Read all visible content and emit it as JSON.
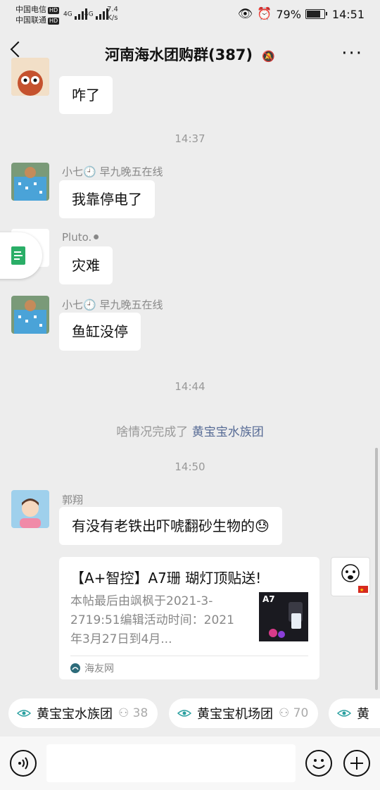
{
  "status_bar": {
    "carrier1": "中国电信",
    "carrier2": "中国联通",
    "hd": "HD",
    "sig": "4G",
    "speed": "7.4",
    "speed_unit": "K/s",
    "battery": "79%",
    "battery_level": 0.79,
    "time": "14:51"
  },
  "nav": {
    "title": "河南海水团购群(387)",
    "more": "···"
  },
  "messages": {
    "m1": {
      "text": "咋了"
    },
    "t1": "14:37",
    "m2": {
      "sender": "小七🕘 早九晚五在线",
      "text": "我靠停电了"
    },
    "m3": {
      "sender": "Pluto.⚫",
      "text": "灾难"
    },
    "m4": {
      "sender": "小七🕘 早九晚五在线",
      "text": "鱼缸没停"
    },
    "t2": "14:44",
    "sys": {
      "prefix": "啥情况完成了",
      "link": "黄宝宝水族团"
    },
    "t3": "14:50",
    "m5": {
      "sender": "郭翔",
      "text": "有没有老铁出吓唬翻砂生物的😓"
    },
    "card": {
      "title": "【A+智控】A7珊 瑚灯顶贴送!",
      "desc": "本帖最后由飒枫于2021-3-2719:51编辑活动时间：2021年3月27日到4月...",
      "thumb_label": "A7",
      "source": "海友网"
    }
  },
  "quickbar": {
    "chips": [
      {
        "label": "黄宝宝水族团",
        "count": "38"
      },
      {
        "label": "黄宝宝机场团",
        "count": "70"
      },
      {
        "label": "黄"
      }
    ]
  },
  "colors": {
    "bg": "#ededed",
    "link": "#576b95",
    "bubble": "#ffffff"
  }
}
